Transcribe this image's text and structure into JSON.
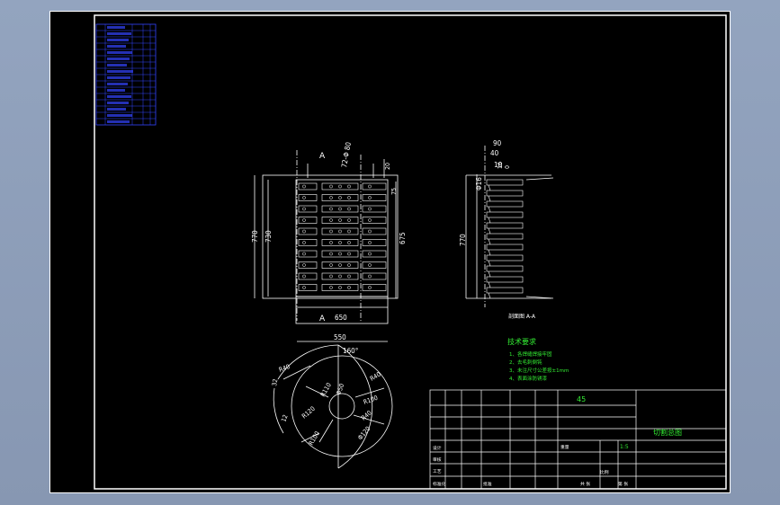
{
  "colors": {
    "background": "#000000",
    "frame": "#ffffff",
    "parts_list": "#3344ff",
    "notes": "#33ee33",
    "surround": "#8c9db8"
  },
  "front_view": {
    "section_mark_top": "A",
    "section_mark_bottom": "A",
    "dims": {
      "top_slots": "72-Φ 80",
      "height_outer": "770",
      "height_inner": "730",
      "width": "650",
      "right_height": "675",
      "right_top": "20",
      "right_small": "75"
    }
  },
  "side_view": {
    "dims": {
      "top": "90",
      "a": "40",
      "b": "10",
      "c": "16",
      "zero": "0",
      "dia": "Φ16",
      "height": "770"
    },
    "section_label": "剖面图 A-A"
  },
  "top_view": {
    "dims": {
      "width": "550",
      "angle": "160°",
      "r40a": "R40",
      "r40b": "R40",
      "r40c": "R40",
      "r100": "R100",
      "r100b": "R100",
      "r120": "R120",
      "r110": "R110",
      "d32": "32",
      "d12": "12",
      "phi50": "Φ50",
      "phi120": "Φ120"
    }
  },
  "tech_requirements": {
    "title": "技术要求",
    "items": [
      "1、各焊缝焊接牢固",
      "2、去毛刺倒钝",
      "3、未注尺寸公差按±1mm",
      "4、表面涂防锈漆"
    ]
  },
  "title_block": {
    "material": "45",
    "drawing_name": "切割总图",
    "scale": "1:5",
    "labels": [
      "设计",
      "审核",
      "工艺",
      "标准化",
      "批准",
      "重量",
      "比例",
      "共 张",
      "第 张"
    ]
  },
  "parts_list": {
    "rows": 16
  }
}
